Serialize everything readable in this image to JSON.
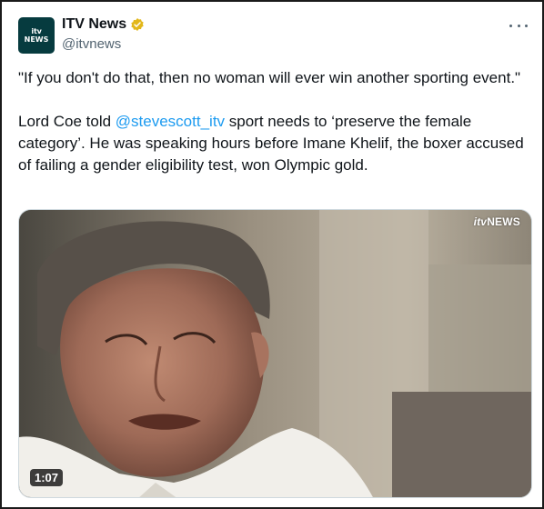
{
  "author": {
    "display_name": "ITV News",
    "handle": "@itvnews",
    "avatar_line1": "itv",
    "avatar_line2": "NEWS",
    "verified_color": "#e2b719"
  },
  "tweet": {
    "paragraph1": "\"If you don't do that, then no woman will ever win another sporting event.\"",
    "p2_before": "Lord Coe told ",
    "p2_mention": "@stevescott_itv",
    "p2_after": " sport needs to ‘preserve the female category’. He was speaking hours before Imane Khelif, the boxer accused of failing a gender eligibility test, won Olympic gold."
  },
  "media": {
    "watermark_prefix": "itv",
    "watermark_suffix": "NEWS",
    "duration": "1:07"
  },
  "colors": {
    "mention": "#1d9bf0",
    "handle": "#536471",
    "avatar_bg": "#063b3f"
  }
}
